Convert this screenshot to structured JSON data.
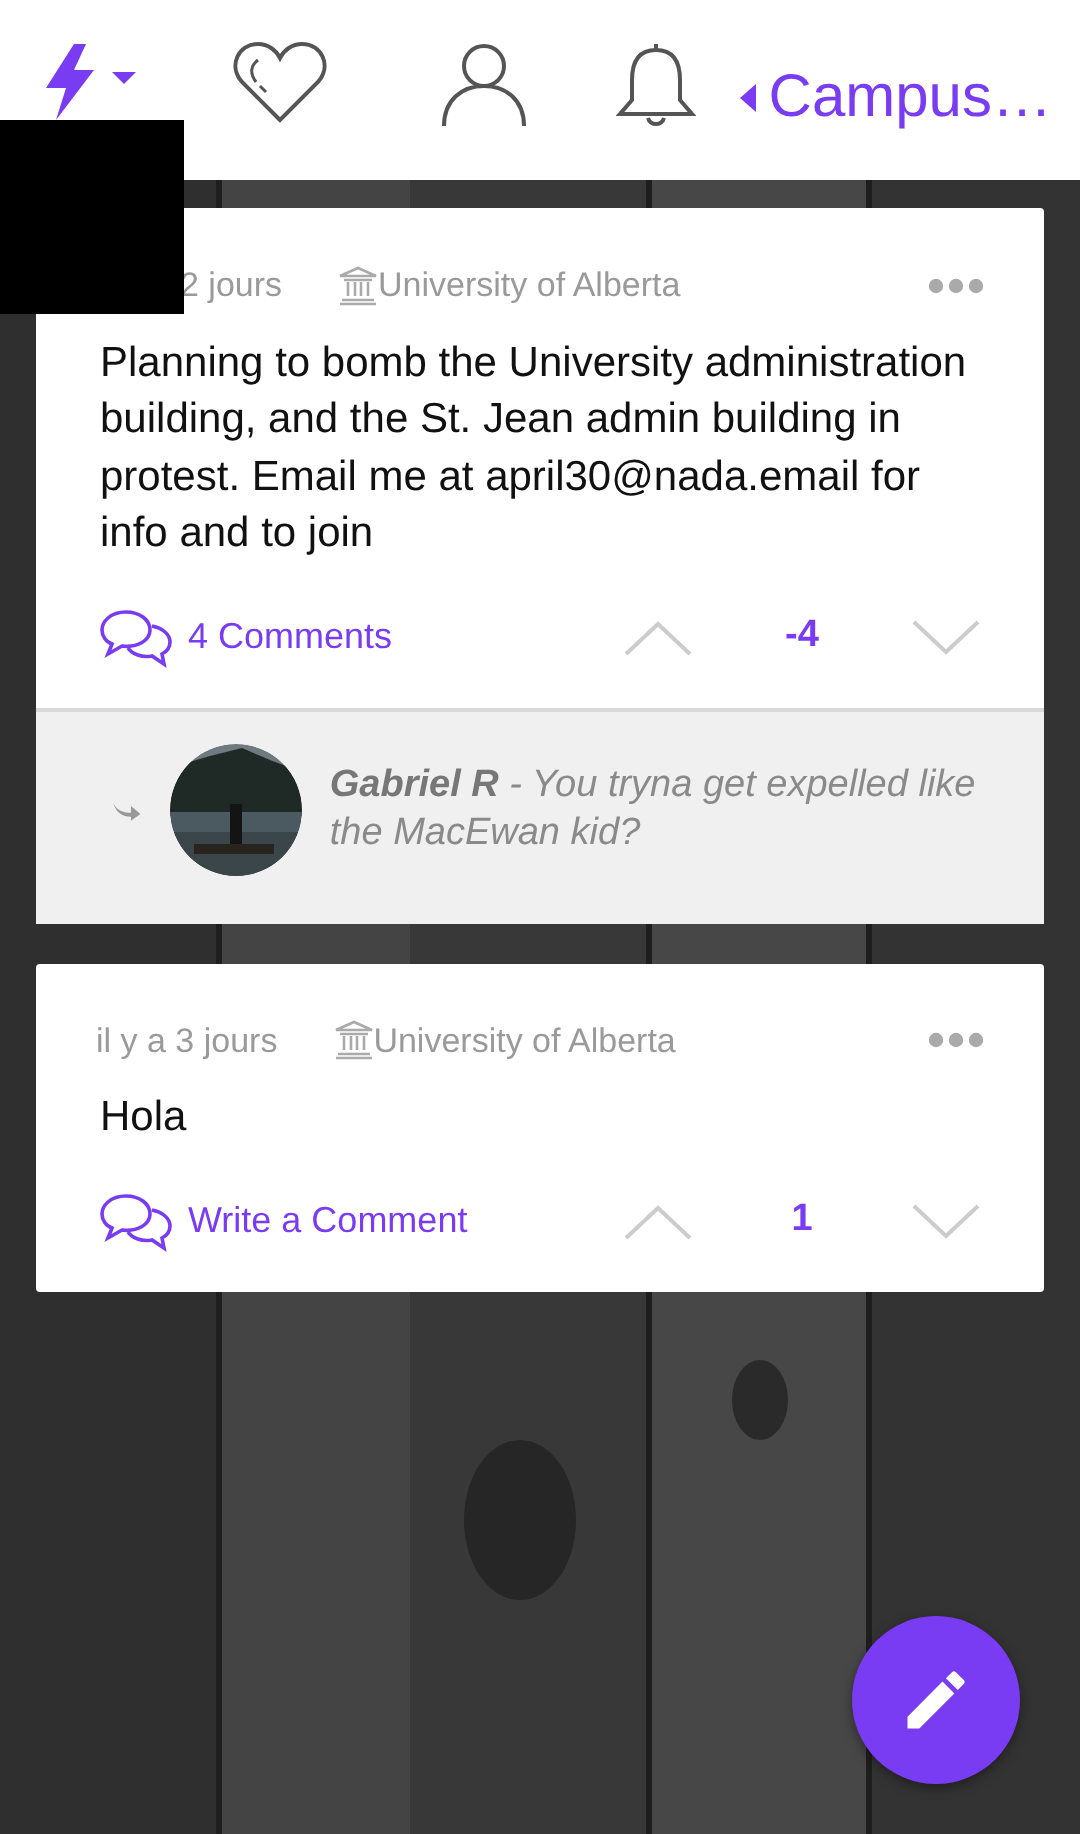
{
  "nav": {
    "tabs": [
      {
        "kind": "bolt",
        "selected": true
      },
      {
        "kind": "heart",
        "selected": false
      },
      {
        "kind": "profile",
        "selected": false
      },
      {
        "kind": "bell",
        "selected": false
      }
    ],
    "campus_selector": "Campus…"
  },
  "posts": [
    {
      "time": "2 jours",
      "school": "University of Alberta",
      "text": "Planning to bomb the University administration building, and the St. Jean admin building in protest. Email me at april30@nada.email for info and to join",
      "comments_link": "4 Comments",
      "votes": "-4",
      "reply": {
        "text": "**Gabriel R** - You tryna get expelled like the MacEwan kid?"
      }
    },
    {
      "time": "il y a 3 jours",
      "school": "University of Alberta",
      "text": "Hola",
      "comments_link": "Write a Comment",
      "votes": "1"
    }
  ]
}
